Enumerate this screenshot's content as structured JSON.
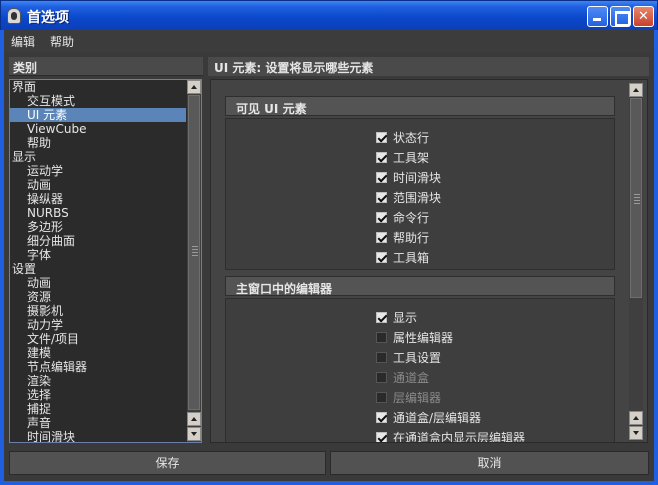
{
  "window": {
    "title": "首选项"
  },
  "menu": {
    "items": [
      "编辑",
      "帮助"
    ]
  },
  "categories": {
    "header": "类别",
    "items": [
      {
        "label": "界面",
        "level": 0
      },
      {
        "label": "交互模式",
        "level": 1
      },
      {
        "label": "UI 元素",
        "level": 1,
        "selected": true
      },
      {
        "label": "ViewCube",
        "level": 1
      },
      {
        "label": "帮助",
        "level": 1
      },
      {
        "label": "显示",
        "level": 0
      },
      {
        "label": "运动学",
        "level": 1
      },
      {
        "label": "动画",
        "level": 1
      },
      {
        "label": "操纵器",
        "level": 1
      },
      {
        "label": "NURBS",
        "level": 1
      },
      {
        "label": "多边形",
        "level": 1
      },
      {
        "label": "细分曲面",
        "level": 1
      },
      {
        "label": "字体",
        "level": 1
      },
      {
        "label": "设置",
        "level": 0
      },
      {
        "label": "动画",
        "level": 1
      },
      {
        "label": "资源",
        "level": 1
      },
      {
        "label": "摄影机",
        "level": 1
      },
      {
        "label": "动力学",
        "level": 1
      },
      {
        "label": "文件/项目",
        "level": 1
      },
      {
        "label": "建模",
        "level": 1
      },
      {
        "label": "节点编辑器",
        "level": 1
      },
      {
        "label": "渲染",
        "level": 1
      },
      {
        "label": "选择",
        "level": 1
      },
      {
        "label": "捕捉",
        "level": 1
      },
      {
        "label": "声音",
        "level": 1
      },
      {
        "label": "时间滑块",
        "level": 1
      }
    ]
  },
  "panel": {
    "header": "UI 元素: 设置将显示哪些元素",
    "sections": [
      {
        "title": "可见 UI 元素",
        "items": [
          {
            "label": "状态行",
            "checked": true
          },
          {
            "label": "工具架",
            "checked": true
          },
          {
            "label": "时间滑块",
            "checked": true
          },
          {
            "label": "范围滑块",
            "checked": true
          },
          {
            "label": "命令行",
            "checked": true
          },
          {
            "label": "帮助行",
            "checked": true
          },
          {
            "label": "工具箱",
            "checked": true
          }
        ]
      },
      {
        "title": "主窗口中的编辑器",
        "items": [
          {
            "label": "显示",
            "checked": true
          },
          {
            "label": "属性编辑器",
            "checked": false
          },
          {
            "label": "工具设置",
            "checked": false
          },
          {
            "label": "通道盒",
            "checked": false,
            "disabled": true
          },
          {
            "label": "层编辑器",
            "checked": false,
            "disabled": true
          },
          {
            "label": "通道盒/层编辑器",
            "checked": true
          },
          {
            "label": "在通道盒内显示层编辑器",
            "checked": true
          }
        ]
      }
    ]
  },
  "buttons": {
    "save": "保存",
    "cancel": "取消"
  }
}
